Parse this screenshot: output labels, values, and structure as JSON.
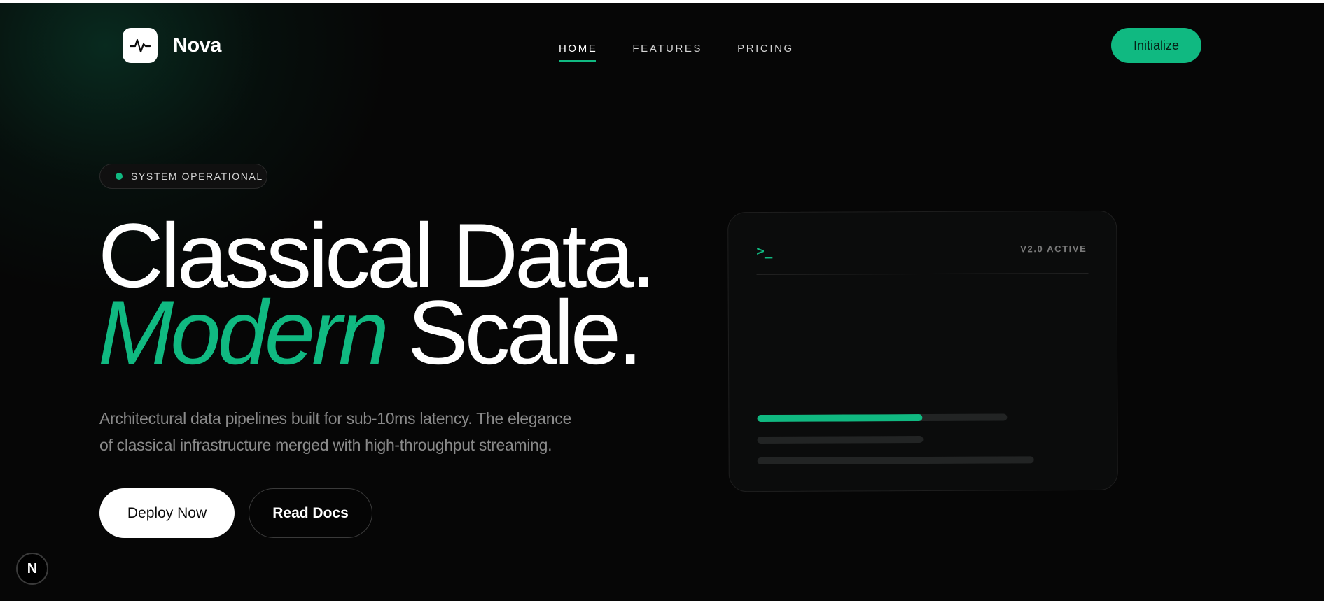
{
  "brand": {
    "name": "Nova",
    "logo_icon": "pulse-icon"
  },
  "nav": {
    "items": [
      {
        "label": "HOME",
        "active": true
      },
      {
        "label": "FEATURES",
        "active": false
      },
      {
        "label": "PRICING",
        "active": false
      }
    ]
  },
  "header": {
    "cta_label": "Initialize"
  },
  "status": {
    "label": "SYSTEM OPERATIONAL",
    "color": "#10b981"
  },
  "hero": {
    "line1": "Classical Data.",
    "line2_accent": "Modern",
    "line2_rest": "Scale.",
    "subtitle": "Architectural data pipelines built for sub-10ms latency. The elegance of classical infrastructure merged with high-throughput streaming.",
    "primary_button": "Deploy Now",
    "secondary_button": "Read Docs"
  },
  "terminal": {
    "prompt": ">_",
    "version": "V2.0 ACTIVE",
    "progress_bars": [
      {
        "track_fraction": 0.75,
        "fill_fraction": 0.66
      },
      {
        "track_fraction": 0.5,
        "fill_fraction": 0.0
      },
      {
        "track_fraction": 0.83,
        "fill_fraction": 0.0
      }
    ]
  },
  "dev_badge": {
    "label": "N"
  },
  "colors": {
    "accent": "#10b981",
    "background": "#060606",
    "text": "#ffffff"
  }
}
